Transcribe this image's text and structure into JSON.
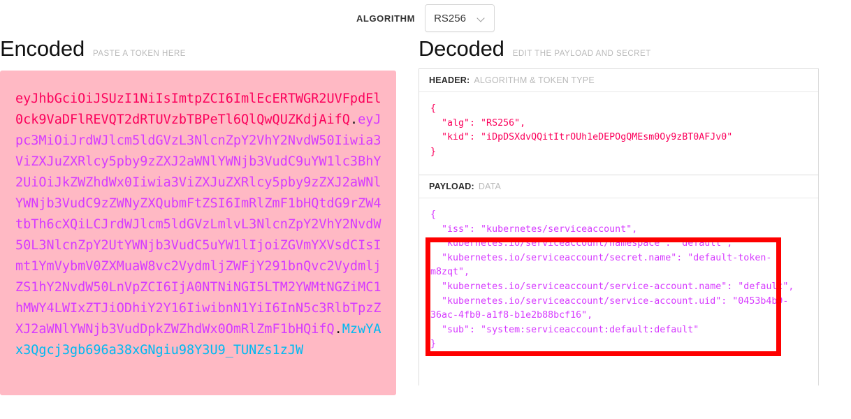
{
  "toolbar": {
    "algorithm_label": "ALGORITHM",
    "algorithm_value": "RS256",
    "chevron_icon": "chevron-down-icon"
  },
  "encoded": {
    "title": "Encoded",
    "subtitle": "PASTE A TOKEN HERE",
    "token": {
      "header": "eyJhbGciOiJSUzI1NiIsImtpZCI6ImlEcERTWGR2UVFpdEl0ck9VaDFlREVQT2dRTUVzbTBPeTl6QlQwQUZKdjAifQ",
      "payload": "eyJpc3MiOiJrdWJlcm5ldGVzL3NlcnZpY2VhY2NvdW50Iiwia3ViZXJuZXRlcy5pby9zZXJ2aWNlYWNjb3VudC9uYW1lc3BhY2UiOiJkZWZhdWx0Iiwia3ViZXJuZXRlcy5pby9zZXJ2aWNlYWNjb3VudC9zZWNyZXQubmFtZSI6ImRlZmF1bHQtdG9rZW4tbTh6cXQiLCJrdWJlcm5ldGVzLmlvL3NlcnZpY2VhY2NvdW50L3NlcnZpY2UtYWNjb3VudC5uYW1lIjoiZGVmYXVsdCIsImt1YmVybmV0ZXMuaW8vc2VydmljZWFjY291bnQvc2VydmljZS1hY2NvdW50LnVpZCI6IjA0NTNiNGI5LTM2YWMtNGZiMC1hMWY4LWIxZTJiODhiY2Y16IiwibnN1YiI6InN5c3RlbTpzZXJ2aWNlYWNjb3VudDpkZWZhdWx0OmRlZmF1bHQifQ",
      "signature": "MzwYAx3Qgcj3gb696a38xGNgiu98Y3U9_TUNZs1zJW"
    }
  },
  "decoded": {
    "title": "Decoded",
    "subtitle": "EDIT THE PAYLOAD AND SECRET",
    "header_panel": {
      "label": "HEADER:",
      "hint": "ALGORITHM & TOKEN TYPE",
      "content": "{\n  \"alg\": \"RS256\",\n  \"kid\": \"iDpDSXdvQQitItrOUh1eDEPOgQMEsm0Oy9zBT0AFJv0\"\n}"
    },
    "payload_panel": {
      "label": "PAYLOAD:",
      "hint": "DATA",
      "content": "{\n  \"iss\": \"kubernetes/serviceaccount\",\n  \"kubernetes.io/serviceaccount/namespace\": \"default\",\n  \"kubernetes.io/serviceaccount/secret.name\": \"default-token-m8zqt\",\n  \"kubernetes.io/serviceaccount/service-account.name\": \"default\",\n  \"kubernetes.io/serviceaccount/service-account.uid\": \"0453b4b9-36ac-4fb0-a1f8-b1e2b88bcf16\",\n  \"sub\": \"system:serviceaccount:default:default\"\n}"
    }
  },
  "annotation": {
    "color": "#fe0000",
    "shape": "rectangle-highlight"
  },
  "colors": {
    "token_background": "#ffb9c4",
    "header_segment": "#fb015b",
    "payload_segment": "#d63aff",
    "signature_segment": "#00b9f1"
  }
}
